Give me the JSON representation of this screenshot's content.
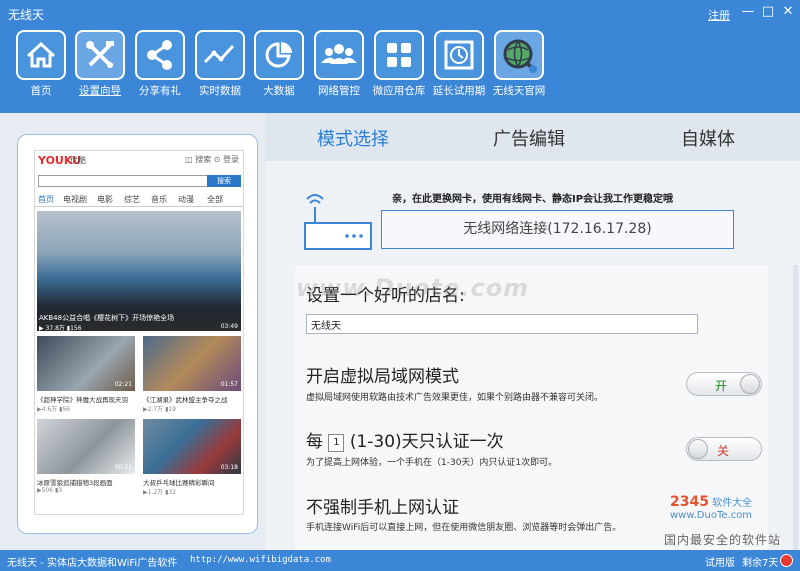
{
  "window": {
    "title": "无线天",
    "login_link": "注册",
    "min_glyph": "—",
    "max_glyph": "□",
    "close_glyph": "✕"
  },
  "nav": [
    {
      "label": "首页",
      "icon": "home-icon"
    },
    {
      "label": "设置向导",
      "icon": "tools-icon"
    },
    {
      "label": "分享有礼",
      "icon": "share-icon"
    },
    {
      "label": "实时数据",
      "icon": "line-chart-icon"
    },
    {
      "label": "大数据",
      "icon": "pie-chart-icon"
    },
    {
      "label": "网络管控",
      "icon": "users-icon"
    },
    {
      "label": "微应用仓库",
      "icon": "grid-icon"
    },
    {
      "label": "延长试用期",
      "icon": "clock-icon"
    },
    {
      "label": "无线天官网",
      "icon": "globe-icon"
    }
  ],
  "preview": {
    "logo": "YOUKU",
    "logo2": "优酷",
    "icons_text": "◫ 搜索 ⊙ 登录",
    "search_btn": "搜索",
    "tabs": [
      "首页",
      "电视剧",
      "电影",
      "综艺",
      "音乐",
      "动漫",
      "全部"
    ],
    "hero_caption": "AKB48公益合唱《樱花树下》开场惊艳全场",
    "hero_sub": "▶ 37.8万 ▮156",
    "hero_dur": "03:49",
    "thumbs": [
      {
        "cap": "《超神学院》神魔大战再现天羽",
        "sub": "▶4.6万 ▮56",
        "dur": "02:21"
      },
      {
        "cap": "《江湖录》武林盟主争夺之战",
        "sub": "▶2.7万 ▮19",
        "dur": "01:57"
      },
      {
        "cap": "冰原雪狼追捕猎物3段画面",
        "sub": "▶506 ▮3",
        "dur": "00:51"
      },
      {
        "cap": "大叔乒乓球比赛精彩瞬间",
        "sub": "▶1.2万 ▮32",
        "dur": "03:18"
      }
    ]
  },
  "tabs": [
    "模式选择",
    "广告编辑",
    "自媒体"
  ],
  "hint": "亲，在此更换网卡，使用有线网卡、静态IP会让我工作更稳定哦",
  "network": "无线网络连接(172.16.17.28)",
  "settings": {
    "name_title": "设置一个好听的店名:",
    "name_value": "无线天",
    "vlan_title": "开启虚拟局域网模式",
    "vlan_desc": "虚拟局域网使用软路由技术广告效果更佳，如果个别路由器不兼容可关闭。",
    "vlan_toggle": "开",
    "auth_prefix": "每",
    "auth_days": "1",
    "auth_suffix": "(1-30)天只认证一次",
    "auth_desc": "为了提高上网体验，一个手机在（1-30天）内只认证1次即可。",
    "auth_toggle": "关",
    "force_title": "不强制手机上网认证",
    "force_desc": "手机连接WiFi后可以直接上网，但在使用微信朋友圈、浏览器等时会弹出广告。"
  },
  "watermark": "www.Duote.com",
  "logo_2345": {
    "brand": "2345",
    "text": "软件大全 www.DuoTe.com"
  },
  "safe_text": "国内最安全的软件站",
  "status": {
    "left": "无线天 - 实体店大数据和WiFi广告软件",
    "url": "http://www.wifibigdata.com",
    "trial": "试用版",
    "remain": "剩余7天"
  },
  "colors": {
    "brand": "#3b86d6",
    "accent": "#2a7fd3",
    "on_green": "#1f8a1f",
    "off_red": "#d23a2e"
  }
}
